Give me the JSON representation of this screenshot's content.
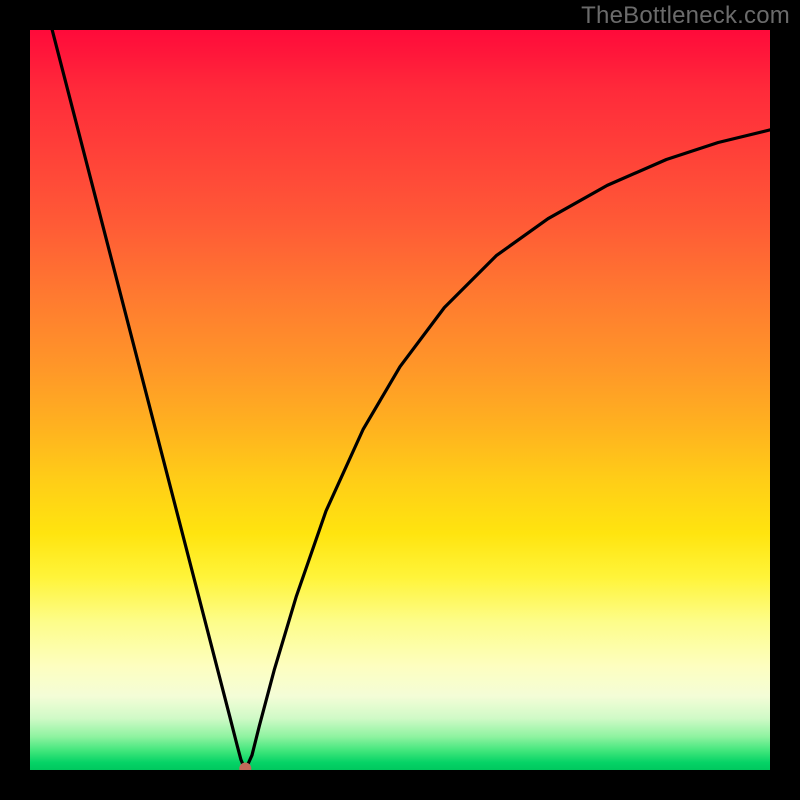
{
  "watermark": "TheBottleneck.com",
  "chart_data": {
    "type": "line",
    "title": "",
    "xlabel": "",
    "ylabel": "",
    "xlim": [
      0,
      1
    ],
    "ylim": [
      0,
      1
    ],
    "series": [
      {
        "name": "curve",
        "x": [
          0.03,
          0.06,
          0.09,
          0.12,
          0.15,
          0.18,
          0.21,
          0.24,
          0.255,
          0.27,
          0.28,
          0.285,
          0.291,
          0.3,
          0.31,
          0.33,
          0.36,
          0.4,
          0.45,
          0.5,
          0.56,
          0.63,
          0.7,
          0.78,
          0.86,
          0.93,
          1.0
        ],
        "values": [
          1.0,
          0.884,
          0.768,
          0.652,
          0.536,
          0.42,
          0.304,
          0.188,
          0.13,
          0.072,
          0.033,
          0.014,
          0.0,
          0.02,
          0.06,
          0.135,
          0.235,
          0.35,
          0.46,
          0.545,
          0.625,
          0.695,
          0.745,
          0.79,
          0.825,
          0.848,
          0.865
        ]
      }
    ],
    "marker": {
      "x": 0.291,
      "y": 0.002
    },
    "legend": ""
  },
  "colors": {
    "gradient_top": "#ff0a3a",
    "gradient_bottom": "#00c85e",
    "curve": "#000000",
    "marker": "#c26a5a",
    "frame": "#000000",
    "watermark": "#6b6b6b"
  }
}
